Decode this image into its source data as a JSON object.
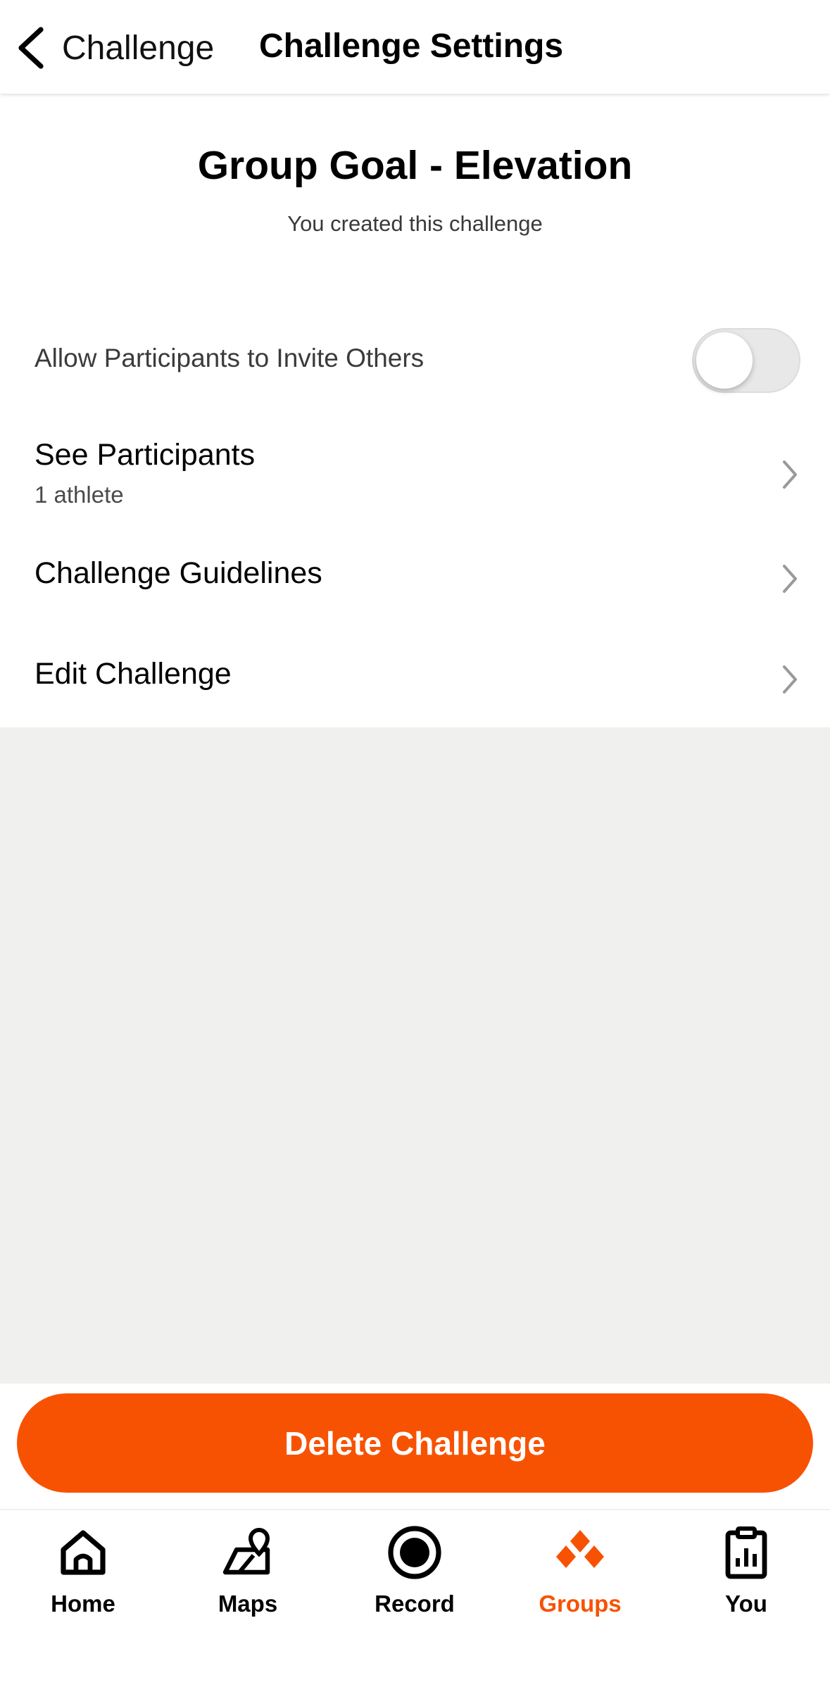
{
  "header": {
    "back_label": "Challenge",
    "title": "Challenge Settings"
  },
  "challenge": {
    "title": "Group Goal - Elevation",
    "subtitle": "You created this challenge"
  },
  "settings": {
    "invite_toggle_label": "Allow Participants to Invite Others",
    "invite_toggle_on": false,
    "see_participants_label": "See Participants",
    "participants_count": "1 athlete",
    "guidelines_label": "Challenge Guidelines",
    "edit_label": "Edit Challenge"
  },
  "delete_button_label": "Delete Challenge",
  "tabbar": {
    "home": "Home",
    "maps": "Maps",
    "record": "Record",
    "groups": "Groups",
    "you": "You",
    "active": "groups"
  },
  "colors": {
    "accent": "#f75202",
    "background_gray": "#f0f0ef"
  }
}
